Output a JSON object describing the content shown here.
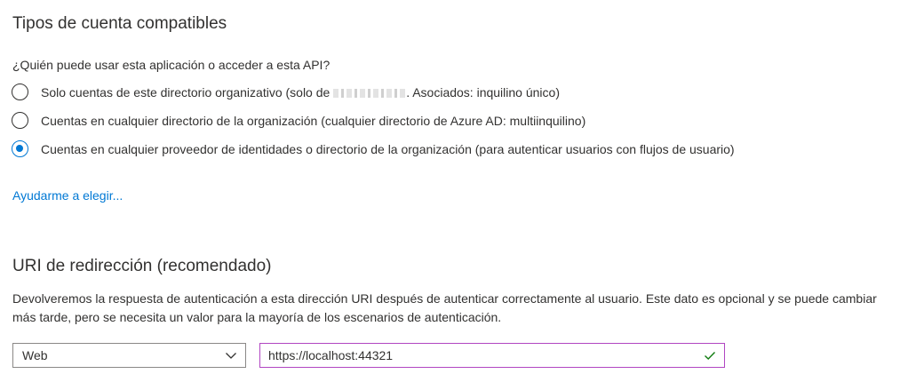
{
  "supported_accounts": {
    "title": "Tipos de cuenta compatibles",
    "question": "¿Quién puede usar esta aplicación o acceder a esta API?",
    "options": [
      {
        "label_before": "Solo cuentas de este directorio organizativo (solo de ",
        "label_after": ". Asociados: inquilino único)",
        "selected": false
      },
      {
        "label": "Cuentas en cualquier directorio de la organización (cualquier directorio de Azure AD: multiinquilino)",
        "selected": false
      },
      {
        "label": "Cuentas en cualquier proveedor de identidades o directorio de la organización (para autenticar usuarios con flujos de usuario)",
        "selected": true
      }
    ],
    "help_link": "Ayudarme a elegir..."
  },
  "redirect_uri": {
    "title": "URI de redirección (recomendado)",
    "description": "Devolveremos la respuesta de autenticación a esta dirección URI después de autenticar correctamente al usuario. Este dato es opcional y se puede cambiar más tarde, pero se necesita un valor para la mayoría de los escenarios de autenticación.",
    "platform": "Web",
    "value": "https://localhost:44321"
  },
  "icons": {
    "dropdown": "chevron-down-icon",
    "valid": "checkmark-icon"
  },
  "colors": {
    "accent": "#0078d4",
    "text": "#323130",
    "input_focus_border": "#b146c2",
    "valid_check": "#107c10"
  }
}
